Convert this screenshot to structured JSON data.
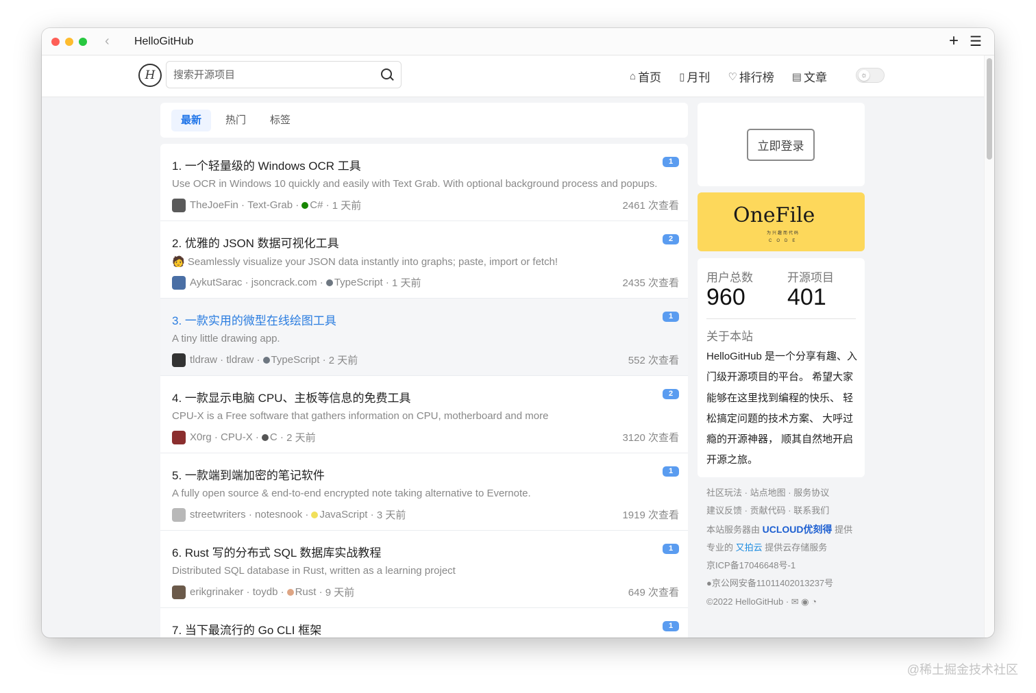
{
  "window": {
    "title": "HelloGitHub",
    "back_icon": "chevron-left-icon",
    "plus_icon": "plus-icon",
    "menu_icon": "menu-icon"
  },
  "header": {
    "logo_text": "H",
    "search_placeholder": "搜索开源项目",
    "nav": [
      {
        "icon": "⌂",
        "icon_name": "home-icon",
        "label": "首页"
      },
      {
        "icon": "▯",
        "icon_name": "book-icon",
        "label": "月刊"
      },
      {
        "icon": "♡",
        "icon_name": "trophy-icon",
        "label": "排行榜"
      },
      {
        "icon": "▤",
        "icon_name": "article-icon",
        "label": "文章"
      }
    ],
    "theme_toggle_icon": "☼"
  },
  "tabs": [
    {
      "label": "最新",
      "active": true
    },
    {
      "label": "热门",
      "active": false
    },
    {
      "label": "标签",
      "active": false
    }
  ],
  "items": [
    {
      "title": "1. 一个轻量级的 Windows OCR 工具",
      "badge": "1",
      "desc": "Use OCR in Windows 10 quickly and easily with Text Grab. With optional background process and popups.",
      "author": "TheJoeFin",
      "repo": "Text-Grab",
      "lang": "C#",
      "lang_color": "#178600",
      "time": "1 天前",
      "views": "2461 次查看",
      "avatar_color": "#5a5a5a",
      "highlight": false
    },
    {
      "title": "2. 优雅的 JSON 数据可视化工具",
      "badge": "2",
      "desc": "🧑 Seamlessly visualize your JSON data instantly into graphs; paste, import or fetch!",
      "author": "AykutSarac",
      "repo": "jsoncrack.com",
      "lang": "TypeScript",
      "lang_color": "#6e7781",
      "time": "1 天前",
      "views": "2435 次查看",
      "avatar_color": "#4a6fa5",
      "highlight": false
    },
    {
      "title": "3. 一款实用的微型在线绘图工具",
      "badge": "1",
      "desc": "A tiny little drawing app.",
      "author": "tldraw",
      "repo": "tldraw",
      "lang": "TypeScript",
      "lang_color": "#6e7781",
      "time": "2 天前",
      "views": "552 次查看",
      "avatar_color": "#333333",
      "highlight": true
    },
    {
      "title": "4. 一款显示电脑 CPU、主板等信息的免费工具",
      "badge": "2",
      "desc": "CPU-X is a Free software that gathers information on CPU, motherboard and more",
      "author": "X0rg",
      "repo": "CPU-X",
      "lang": "C",
      "lang_color": "#555555",
      "time": "2 天前",
      "views": "3120 次查看",
      "avatar_color": "#8b2e2e",
      "highlight": false
    },
    {
      "title": "5. 一款端到端加密的笔记软件",
      "badge": "1",
      "desc": "A fully open source & end-to-end encrypted note taking alternative to Evernote.",
      "author": "streetwriters",
      "repo": "notesnook",
      "lang": "JavaScript",
      "lang_color": "#f1e05a",
      "time": "3 天前",
      "views": "1919 次查看",
      "avatar_color": "#b8b8b8",
      "highlight": false
    },
    {
      "title": "6. Rust 写的分布式 SQL 数据库实战教程",
      "badge": "1",
      "desc": "Distributed SQL database in Rust, written as a learning project",
      "author": "erikgrinaker",
      "repo": "toydb",
      "lang": "Rust",
      "lang_color": "#dea584",
      "time": "9 天前",
      "views": "649 次查看",
      "avatar_color": "#6b5a4a",
      "highlight": false
    },
    {
      "title": "7. 当下最流行的 Go CLI 框架",
      "badge": "1",
      "desc": "",
      "author": "",
      "repo": "",
      "lang": "",
      "lang_color": "#ffffff",
      "time": "",
      "views": "",
      "avatar_color": "#ffffff",
      "highlight": false
    }
  ],
  "sidebar": {
    "login_label": "立即登录",
    "ad_logo": "OneFile",
    "ad_sub": "为兴趣而代码",
    "ad_code": "CODE",
    "users_label": "用户总数",
    "users_value": "960",
    "projects_label": "开源项目",
    "projects_value": "401",
    "about_title": "关于本站",
    "about_text": "HelloGitHub 是一个分享有趣、入门级开源项目的平台。 希望大家能够在这里找到编程的快乐、 轻松搞定问题的技术方案、 大呼过瘾的开源神器， 顺其自然地开启开源之旅。"
  },
  "footer": {
    "line1": [
      "社区玩法",
      "站点地图",
      "服务协议"
    ],
    "line2": [
      "建议反馈",
      "贡献代码",
      "联系我们"
    ],
    "line3_pre": "本站服务器由",
    "line3_brand": "UCLOUD优刻得",
    "line3_post": "提供",
    "line4_pre": "专业的",
    "line4_brand": "又拍云",
    "line4_post": "提供云存储服务",
    "icp": "京ICP备17046648号-1",
    "police": "京公网安备11011402013237号",
    "copyright": "©2022 HelloGitHub",
    "social_icons": [
      "wechat-icon",
      "weibo-icon",
      "rss-icon"
    ]
  },
  "watermark": "@稀土掘金技术社区"
}
